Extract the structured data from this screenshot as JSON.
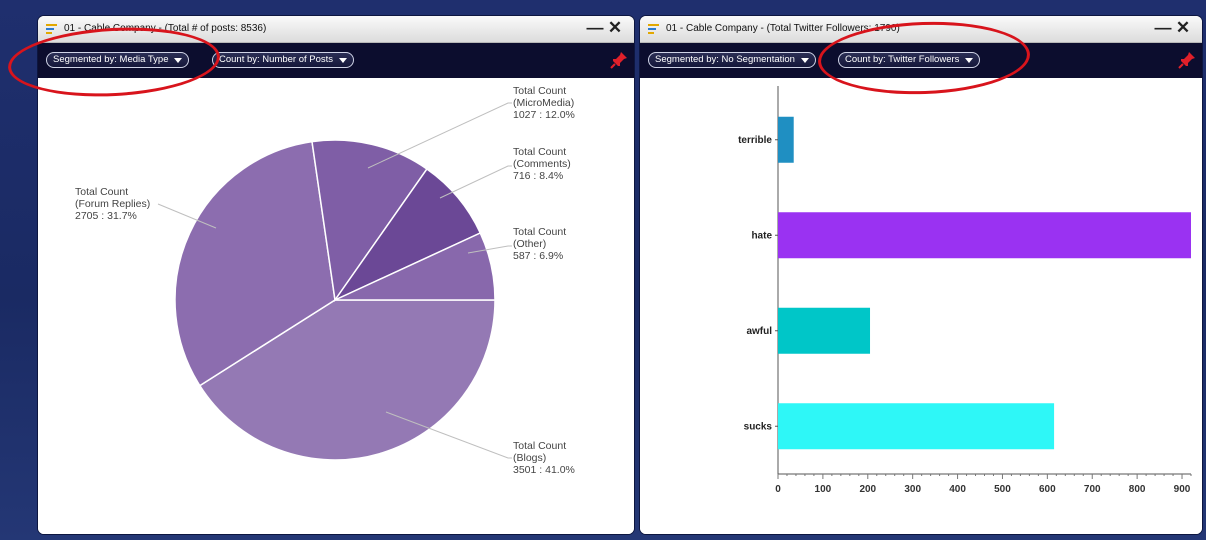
{
  "left_panel": {
    "title": "01 - Cable Company - (Total # of posts: 8536)",
    "segmented_by": "Segmented by: Media Type",
    "count_by": "Count by: Number of Posts",
    "min_glyph": "—",
    "close_glyph": "✕"
  },
  "right_panel": {
    "title": "01 - Cable Company - (Total Twitter Followers: 1790)",
    "segmented_by": "Segmented by: No Segmentation",
    "count_by": "Count by: Twitter Followers",
    "min_glyph": "—",
    "close_glyph": "✕"
  },
  "icons": {
    "title_icon": "list-icon",
    "pin_icon": "pin-icon",
    "caret_icon": "chevron-down-icon",
    "pin_color": "#e0202a"
  },
  "annotation_color": "#d8141c",
  "chart_data": [
    {
      "type": "pie",
      "slices": [
        {
          "label": "Total Count\n(Blogs)",
          "value": 3501,
          "pct_text": "3501 : 41.0%",
          "color": "#9479b4"
        },
        {
          "label": "Total Count\n(Forum Replies)",
          "value": 2705,
          "pct_text": "2705 : 31.7%",
          "color": "#8c6daf"
        },
        {
          "label": "Total Count\n(MicroMedia)",
          "value": 1027,
          "pct_text": "1027 : 12.0%",
          "color": "#7f5ea6"
        },
        {
          "label": "Total Count\n(Comments)",
          "value": 716,
          "pct_text": "716 : 8.4%",
          "color": "#6b4896"
        },
        {
          "label": "Total Count\n(Other)",
          "value": 587,
          "pct_text": "587 : 6.9%",
          "color": "#8868ac"
        }
      ]
    },
    {
      "type": "bar",
      "orientation": "horizontal",
      "categories": [
        "terrible",
        "hate",
        "awful",
        "sucks"
      ],
      "values": [
        35,
        920,
        205,
        615
      ],
      "colors": [
        "#1f8fc2",
        "#9a32f2",
        "#00c6c8",
        "#2ef7f7"
      ],
      "xlim": [
        0,
        920
      ],
      "xticks": [
        0,
        100,
        200,
        300,
        400,
        500,
        600,
        700,
        800,
        900
      ]
    }
  ]
}
